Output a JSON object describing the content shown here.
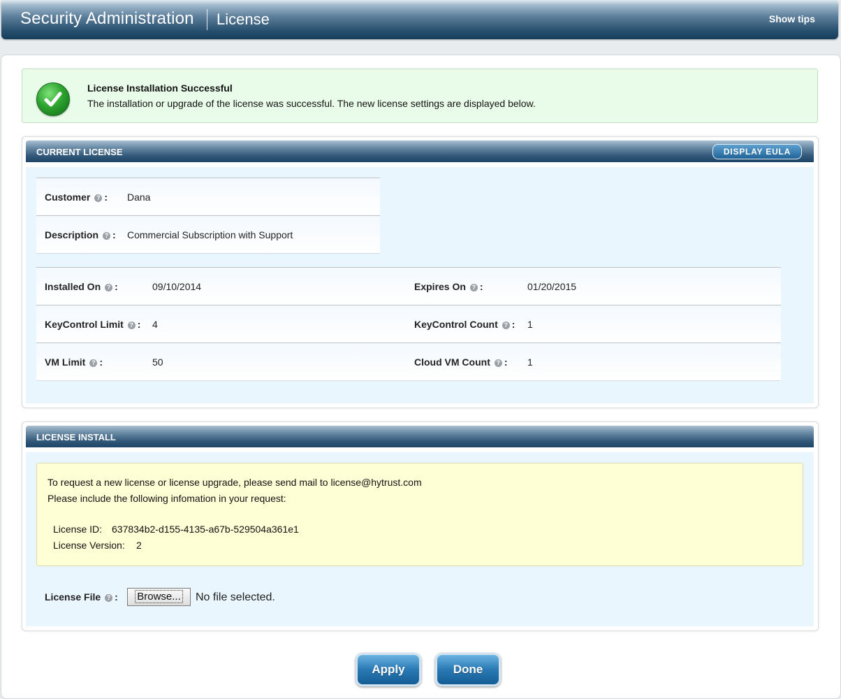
{
  "header": {
    "title": "Security Administration",
    "subtitle": "License",
    "tips_label": "Show tips"
  },
  "success": {
    "title": "License Installation Successful",
    "message": "The installation or upgrade of the license was successful. The new license settings are displayed below.",
    "icon": "check-circle-icon"
  },
  "current_license": {
    "title": "CURRENT LICENSE",
    "eula_label": "DISPLAY EULA",
    "customer_label": "Customer",
    "customer_value": "Dana",
    "description_label": "Description",
    "description_value": "Commercial Subscription with Support",
    "installed_on_label": "Installed On",
    "installed_on_value": "09/10/2014",
    "expires_on_label": "Expires On",
    "expires_on_value": "01/20/2015",
    "keycontrol_limit_label": "KeyControl Limit",
    "keycontrol_limit_value": "4",
    "keycontrol_count_label": "KeyControl Count",
    "keycontrol_count_value": "1",
    "vm_limit_label": "VM Limit",
    "vm_limit_value": "50",
    "cloud_vm_count_label": "Cloud VM Count",
    "cloud_vm_count_value": "1"
  },
  "license_install": {
    "title": "LICENSE INSTALL",
    "request_line": "To request a new license or license upgrade, please send mail to license@hytrust.com",
    "include_line": "Please include the following infomation in your request:",
    "license_id_label": "License ID:",
    "license_id_value": "637834b2-d155-4135-a67b-529504a361e1",
    "license_version_label": "License Version:",
    "license_version_value": "2",
    "file_label": "License File",
    "browse_label": "Browse...",
    "no_file_text": "No file selected."
  },
  "actions": {
    "apply_label": "Apply",
    "done_label": "Done"
  },
  "colors": {
    "header_dark": "#163d5b",
    "success_bg": "#e9fbe9",
    "panel_body": "#eaf6fd",
    "info_bg": "#ffffd6",
    "button_blue": "#2a79b4"
  }
}
